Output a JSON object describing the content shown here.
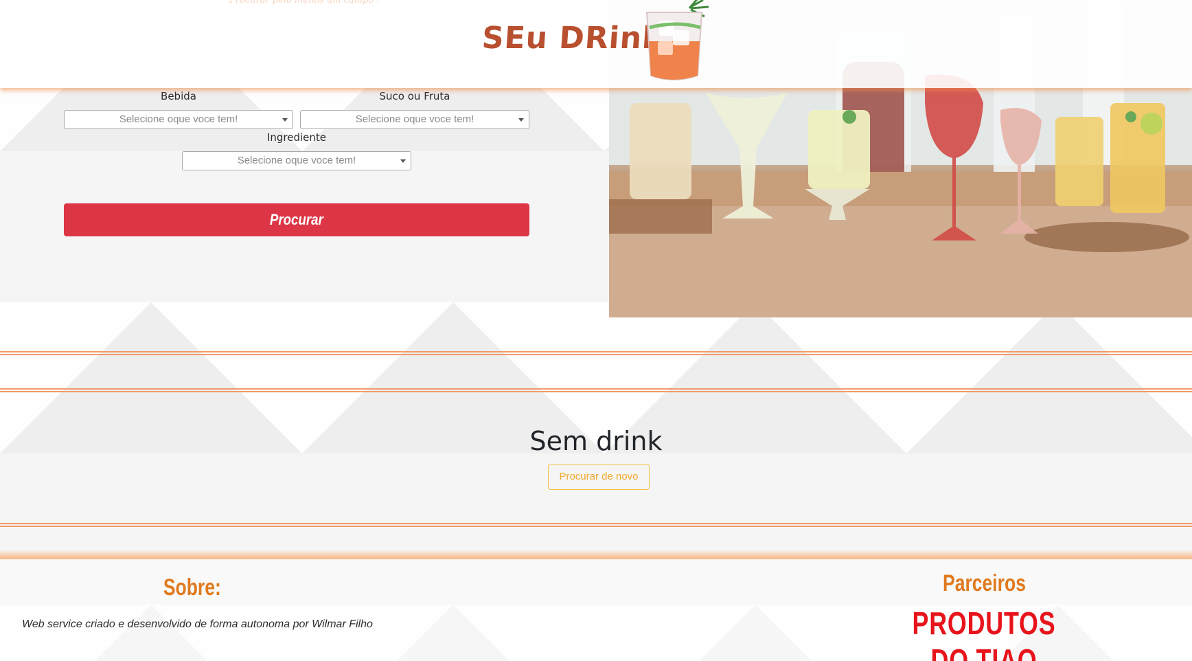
{
  "header": {
    "faded_hint": "Procurar pelo menos um campo !",
    "logo_text": "SEu DRink",
    "logo_icon": "cocktail-glass-icon"
  },
  "hero": {
    "image": "drinks-photo"
  },
  "form": {
    "bebida": {
      "label": "Bebida",
      "selected": "Selecione oque voce tem!"
    },
    "suco": {
      "label": "Suco ou Fruta",
      "selected": "Selecione oque voce tem!"
    },
    "ingrediente": {
      "label": "Ingrediente",
      "selected": "Selecione oque voce tem!"
    },
    "search_label": "Procurar"
  },
  "results": {
    "title": "Sem drink",
    "retry_label": "Procurar de novo"
  },
  "footer": {
    "about_title": "Sobre:",
    "about_text": "Web service criado e desenvolvido de forma autonoma por Wilmar Filho",
    "partners_title": "Parceiros",
    "partner_name": "PRODUTOS DO TIAO"
  },
  "colors": {
    "accent_orange": "#f29a6a",
    "button_red": "#dc3545",
    "title_orange": "#e07a1f",
    "partner_red": "#e8141c",
    "retry_yellow": "#f0c040"
  }
}
